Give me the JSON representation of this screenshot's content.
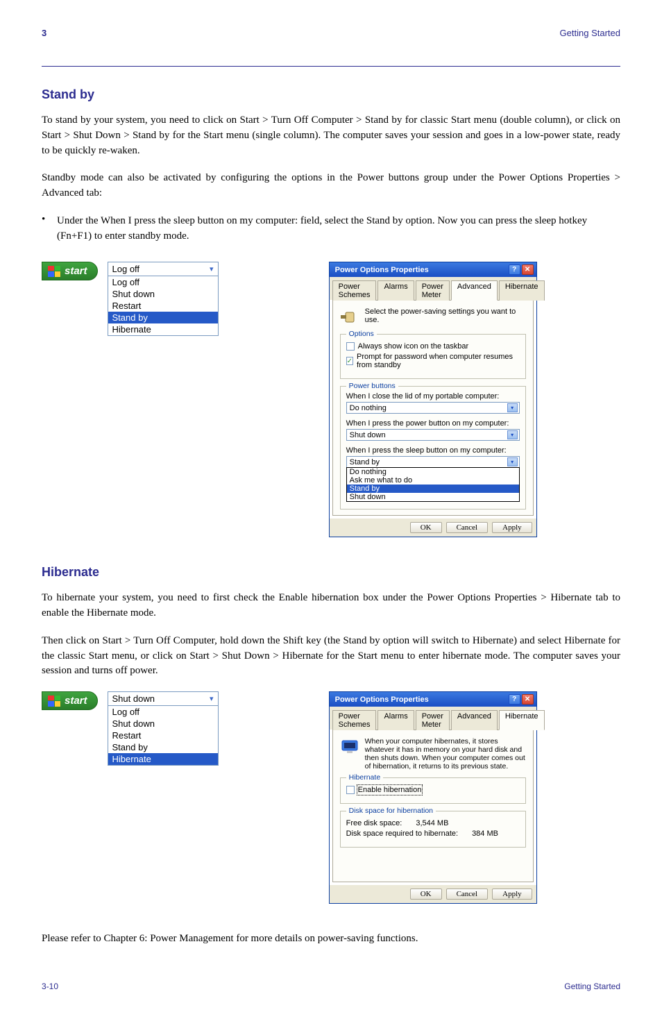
{
  "header": {
    "section_number": "3",
    "section_name": "Getting Started",
    "page_prefix": "3-",
    "page_number": "10"
  },
  "standby_section": {
    "title": "Stand by",
    "p1": "To stand by your system, you need to click on Start > Turn Off Computer > Stand by for classic Start menu (double column), or click on Start > Shut Down > Stand by for the Start menu (single column). The computer saves your session and goes in a low-power state, ready to be quickly re-waken.",
    "p2": "Standby mode can also be activated by configuring the options in the Power buttons group under the Power Options Properties > Advanced tab:",
    "bullet": "Under the When I press the sleep button on my computer: field, select the Stand by option. Now you can press the sleep hotkey (Fn+F1) to enter standby mode."
  },
  "fig1": {
    "start_label": "start",
    "dropdown_selected": "Log off",
    "items": [
      "Log off",
      "Shut down",
      "Restart",
      "Stand by",
      "Hibernate"
    ],
    "highlighted": "Stand by"
  },
  "dialog1": {
    "title": "Power Options Properties",
    "tabs": [
      "Power Schemes",
      "Alarms",
      "Power Meter",
      "Advanced",
      "Hibernate"
    ],
    "active_tab": "Advanced",
    "intro": "Select the power-saving settings you want to use.",
    "options_legend": "Options",
    "chk1": "Always show icon on the taskbar",
    "chk1_checked": false,
    "chk2": "Prompt for password when computer resumes from standby",
    "chk2_checked": true,
    "buttons_legend": "Power buttons",
    "lbl_lid": "When I close the lid of my portable computer:",
    "sel_lid": "Do nothing",
    "lbl_power": "When I press the power button on my computer:",
    "sel_power": "Shut down",
    "lbl_sleep": "When I press the sleep button on my computer:",
    "sel_sleep": "Stand by",
    "sleep_options": [
      "Do nothing",
      "Ask me what to do",
      "Stand by",
      "Shut down"
    ],
    "sleep_highlighted": "Stand by",
    "ok": "OK",
    "cancel": "Cancel",
    "apply": "Apply"
  },
  "hibernate_section": {
    "title": "Hibernate",
    "p1": "To hibernate your system, you need to first check the Enable hibernation box under the Power Options Properties > Hibernate tab to enable the Hibernate mode.",
    "p2": "Then click on Start > Turn Off Computer, hold down the Shift key (the Stand by option will switch to Hibernate) and select Hibernate for the classic Start menu, or click on Start > Shut Down > Hibernate for the Start menu to enter hibernate mode. The computer saves your session and turns off power.",
    "bottom_note": "Please refer to Chapter 6: Power Management for more details on power-saving functions."
  },
  "fig2": {
    "start_label": "start",
    "dropdown_selected": "Shut down",
    "items": [
      "Log off",
      "Shut down",
      "Restart",
      "Stand by",
      "Hibernate"
    ],
    "highlighted": "Hibernate"
  },
  "dialog2": {
    "title": "Power Options Properties",
    "tabs": [
      "Power Schemes",
      "Alarms",
      "Power Meter",
      "Advanced",
      "Hibernate"
    ],
    "active_tab": "Hibernate",
    "intro": "When your computer hibernates, it stores whatever it has in memory on your hard disk and then shuts down. When your computer comes out of hibernation, it returns to its previous state.",
    "hib_legend": "Hibernate",
    "chk_enable": "Enable hibernation",
    "chk_enable_checked": false,
    "disk_legend": "Disk space for hibernation",
    "free_label": "Free disk space:",
    "free_value": "3,544 MB",
    "req_label": "Disk space required to hibernate:",
    "req_value": "384 MB",
    "ok": "OK",
    "cancel": "Cancel",
    "apply": "Apply"
  },
  "footer": {
    "right": "Getting Started"
  }
}
